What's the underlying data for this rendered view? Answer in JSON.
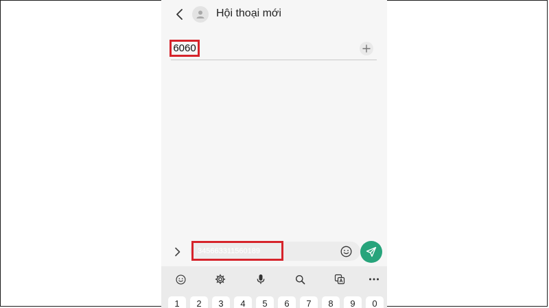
{
  "header": {
    "title": "Hội thoại mới",
    "back_icon": "chevron-left-icon",
    "avatar_icon": "person-icon"
  },
  "recipient": {
    "value": "6060",
    "add_icon": "plus-icon"
  },
  "composer": {
    "message_value": "345663311560189",
    "expand_icon": "chevron-right-icon",
    "emoji_icon": "smiley-icon",
    "send_icon": "send-icon"
  },
  "keyboard": {
    "toolbar_icons": [
      "smiley-icon",
      "gear-icon",
      "microphone-icon",
      "search-icon",
      "translate-icon",
      "more-icon"
    ],
    "number_keys": [
      "1",
      "2",
      "3",
      "4",
      "5",
      "6",
      "7",
      "8",
      "9",
      "0"
    ]
  },
  "colors": {
    "highlight": "#d6232a",
    "send_button": "#27a47b",
    "screen_background": "#f6f6f6",
    "keyboard_background": "#ebebeb"
  }
}
